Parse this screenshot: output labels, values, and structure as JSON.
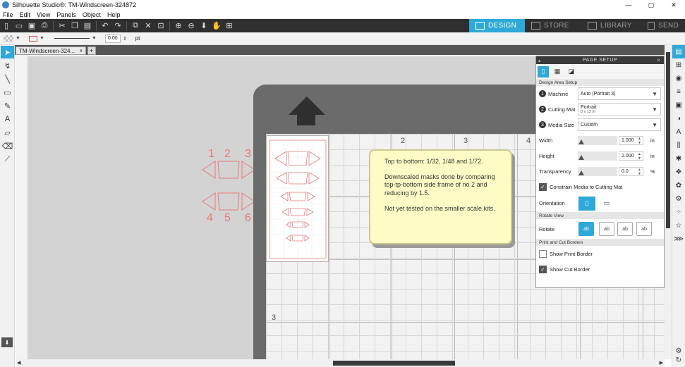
{
  "window": {
    "title": "Silhouette Studio®: TM-Windscreen-324872",
    "minimize": "—",
    "maximize": "▢",
    "close": "✕"
  },
  "menu": [
    "File",
    "Edit",
    "View",
    "Panels",
    "Object",
    "Help"
  ],
  "nav_tabs": [
    {
      "label": "DESIGN",
      "active": true
    },
    {
      "label": "STORE",
      "active": false
    },
    {
      "label": "LIBRARY",
      "active": false
    },
    {
      "label": "SEND",
      "active": false
    }
  ],
  "propbar": {
    "line_width": "0.00",
    "unit": "pt"
  },
  "doc_tab": {
    "name": "TM-Windscreen-324...",
    "close": "x",
    "add": "+"
  },
  "mat_numbers": [
    "2",
    "3",
    "4",
    "3"
  ],
  "shape_numbers": [
    "1",
    "2",
    "3",
    "4",
    "5",
    "6"
  ],
  "note": {
    "line1": "Top to bottom: 1/32, 1/48 and 1/72.",
    "line2": "Downscaled masks done by comparing top-tp-bottom side frame of no 2 and reducing by 1.5.",
    "line3": "Not yet tested on the smaller scale kits."
  },
  "page_setup": {
    "title": "PAGE SETUP",
    "section_design_area": "Design Area Setup",
    "machine": {
      "step": "1",
      "label": "Machine",
      "value": "Auto (Portrait 3)"
    },
    "cutting_mat": {
      "step": "2",
      "label": "Cutting Mat",
      "value": "Portrait",
      "sub": "8 x 12 in"
    },
    "media_size": {
      "step": "3",
      "label": "Media Size",
      "value": "Custom"
    },
    "width": {
      "label": "Width",
      "value": "1.000",
      "unit": "in"
    },
    "height": {
      "label": "Height",
      "value": "2.000",
      "unit": "in"
    },
    "transparency": {
      "label": "Transparency",
      "value": "0.0",
      "unit": "%"
    },
    "constrain": {
      "label": "Constrain Media to Cutting Mat",
      "checked": true
    },
    "orientation_label": "Orientation",
    "section_rotate": "Rotate View",
    "rotate_label": "Rotate",
    "rotate_options": [
      "ab",
      "ab",
      "ab",
      "ab"
    ],
    "section_print_cut": "Print and Cut Borders",
    "show_print_border": {
      "label": "Show Print Border",
      "checked": false
    },
    "show_cut_border": {
      "label": "Show Cut Border",
      "checked": true
    }
  },
  "colors": {
    "accent": "#2ea9d8",
    "toolbar": "#2f2f2f",
    "note_bg": "#fffcc5",
    "cut_line": "#e87878"
  }
}
